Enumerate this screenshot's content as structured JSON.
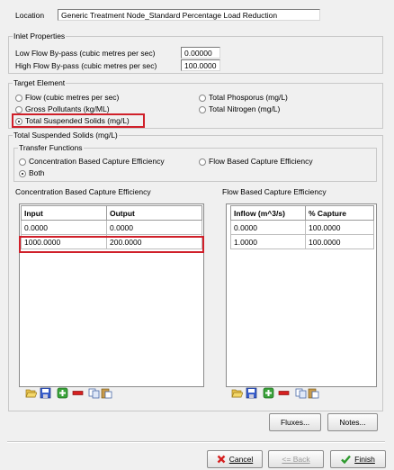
{
  "location": {
    "label": "Location",
    "value": "Generic Treatment Node_Standard Percentage Load Reduction"
  },
  "inlet": {
    "title": "Inlet Properties",
    "low_label": "Low Flow By-pass (cubic metres per sec)",
    "low_value": "0.00000",
    "high_label": "High Flow By-pass (cubic metres per sec)",
    "high_value": "100.0000"
  },
  "target": {
    "title": "Target Element",
    "options": [
      {
        "label": "Flow (cubic metres per sec)",
        "checked": false
      },
      {
        "label": "Total Phosporus (mg/L)",
        "checked": false
      },
      {
        "label": "Gross Pollutants (kg/ML)",
        "checked": false
      },
      {
        "label": "Total Nitrogen (mg/L)",
        "checked": false
      },
      {
        "label": "Total Suspended Solids (mg/L)",
        "checked": true
      }
    ]
  },
  "tss": {
    "title": "Total Suspended Solids (mg/L)",
    "transfer": {
      "title": "Transfer Functions",
      "opt_conc": "Concentration Based Capture Efficiency",
      "opt_flow": "Flow Based Capture Efficiency",
      "opt_both": "Both",
      "selected": "Both"
    },
    "conc": {
      "title": "Concentration Based Capture Efficiency",
      "headers": [
        "Input",
        "Output"
      ],
      "rows": [
        [
          "0.0000",
          "0.0000"
        ],
        [
          "1000.0000",
          "200.0000"
        ]
      ]
    },
    "flow": {
      "title": "Flow Based Capture Efficiency",
      "headers": [
        "Inflow (m^3/s)",
        "% Capture"
      ],
      "rows": [
        [
          "0.0000",
          "100.0000"
        ],
        [
          "1.0000",
          "100.0000"
        ]
      ]
    }
  },
  "buttons": {
    "fluxes": "Fluxes...",
    "notes": "Notes...",
    "cancel": "Cancel",
    "back": "<= Back",
    "finish": "Finish"
  },
  "colors": {
    "highlight": "#d0202a",
    "cancel_x": "#d62020",
    "finish_check": "#2e9a2e"
  }
}
